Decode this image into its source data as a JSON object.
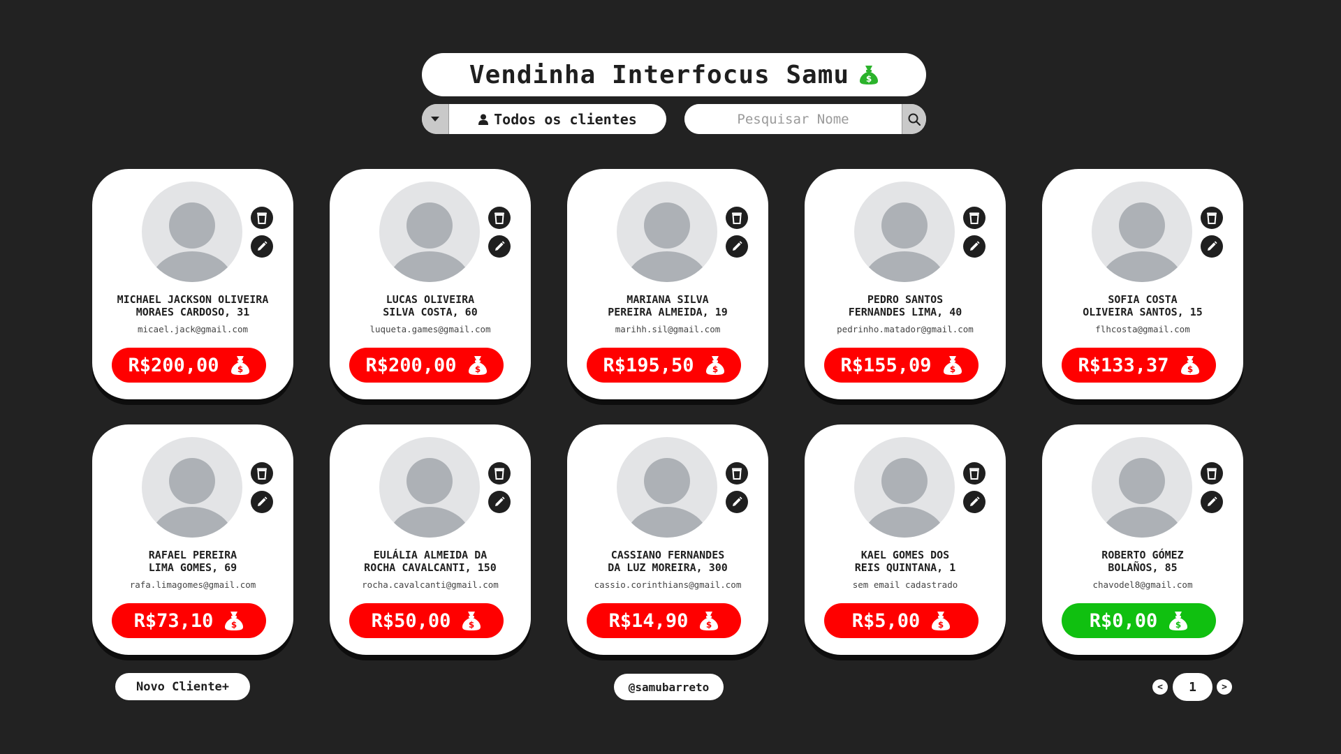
{
  "header": {
    "title": "Vendinha Interfocus Samu",
    "filter_label": "Todos os clientes",
    "search_placeholder": "Pesquisar Nome",
    "search_value": ""
  },
  "icons": {
    "title_icon": "moneybag-icon",
    "filter_toggle": "caret-down-icon",
    "filter_person": "person-icon",
    "search": "search-icon",
    "delete": "trash-icon",
    "edit": "pencil-icon",
    "balance": "moneybag-icon",
    "avatar": "default-avatar-icon"
  },
  "colors": {
    "background": "#222222",
    "debt": "#ff0000",
    "paid": "#10c010",
    "moneybag_title": "#2bb32b"
  },
  "clients": [
    {
      "name_line1": "MICHAEL JACKSON OLIVEIRA",
      "name_line2": "MORAES CARDOSO, 31",
      "email": "micael.jack@gmail.com",
      "balance": "R$200,00",
      "status": "debt"
    },
    {
      "name_line1": "LUCAS OLIVEIRA",
      "name_line2": "SILVA COSTA, 60",
      "email": "luqueta.games@gmail.com",
      "balance": "R$200,00",
      "status": "debt"
    },
    {
      "name_line1": "MARIANA SILVA",
      "name_line2": "PEREIRA ALMEIDA, 19",
      "email": "marihh.sil@gmail.com",
      "balance": "R$195,50",
      "status": "debt"
    },
    {
      "name_line1": "PEDRO SANTOS",
      "name_line2": "FERNANDES LIMA, 40",
      "email": "pedrinho.matador@gmail.com",
      "balance": "R$155,09",
      "status": "debt"
    },
    {
      "name_line1": "SOFIA COSTA",
      "name_line2": "OLIVEIRA SANTOS, 15",
      "email": "flhcosta@gmail.com",
      "balance": "R$133,37",
      "status": "debt"
    },
    {
      "name_line1": "RAFAEL PEREIRA",
      "name_line2": "LIMA GOMES, 69",
      "email": "rafa.limagomes@gmail.com",
      "balance": "R$73,10",
      "status": "debt"
    },
    {
      "name_line1": "EULÁLIA ALMEIDA DA",
      "name_line2": "ROCHA CAVALCANTI, 150",
      "email": "rocha.cavalcanti@gmail.com",
      "balance": "R$50,00",
      "status": "debt"
    },
    {
      "name_line1": "CASSIANO FERNANDES",
      "name_line2": "DA LUZ MOREIRA, 300",
      "email": "cassio.corinthians@gmail.com",
      "balance": "R$14,90",
      "status": "debt"
    },
    {
      "name_line1": "KAEL GOMES DOS",
      "name_line2": "REIS QUINTANA, 1",
      "email": "sem email cadastrado",
      "balance": "R$5,00",
      "status": "debt"
    },
    {
      "name_line1": "ROBERTO GÓMEZ",
      "name_line2": "BOLAÑOS, 85",
      "email": "chavodel8@gmail.com",
      "balance": "R$0,00",
      "status": "paid"
    }
  ],
  "footer": {
    "new_client_label": "Novo Cliente+",
    "credit": "@samubarreto",
    "prev_label": "<",
    "next_label": ">",
    "current_page": "1"
  }
}
